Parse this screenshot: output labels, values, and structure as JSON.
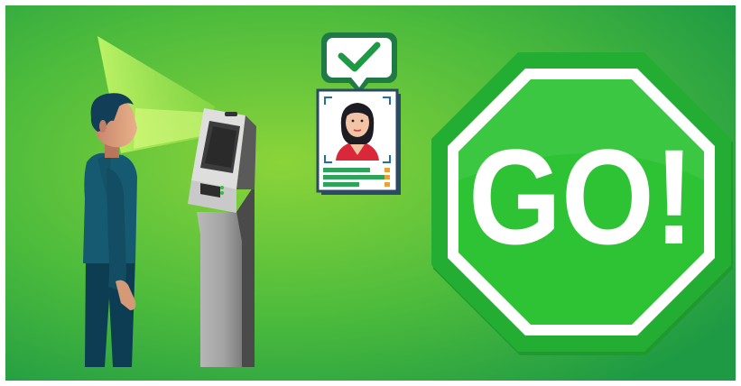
{
  "sign": {
    "text": "GO!",
    "face_color": "#2ec335",
    "ring_color": "#ffffff",
    "edge_color": "#1f9a2e"
  },
  "background": {
    "center_color": "#8bd43a",
    "edge_color": "#1e9a44"
  },
  "verification": {
    "status": "approved",
    "check_icon": "checkmark-icon",
    "id_card_icon": "id-card-icon"
  }
}
